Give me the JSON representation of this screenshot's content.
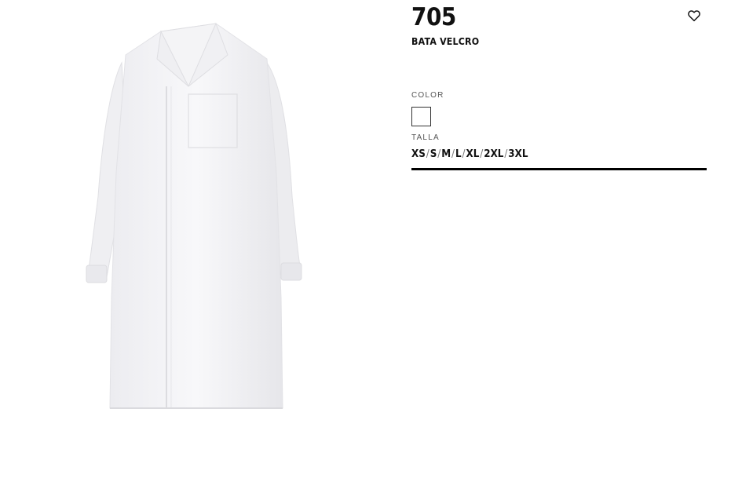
{
  "product": {
    "ref": "705",
    "name": "BATA VELCRO"
  },
  "color": {
    "label": "COLOR",
    "selected": "#ffffff"
  },
  "size": {
    "label": "TALLA",
    "options": [
      "XS",
      "S",
      "M",
      "L",
      "XL",
      "2XL",
      "3XL"
    ]
  },
  "icons": {
    "favorite": "heart-outline-icon"
  },
  "colors": {
    "text": "#111111",
    "divider": "#000000"
  }
}
